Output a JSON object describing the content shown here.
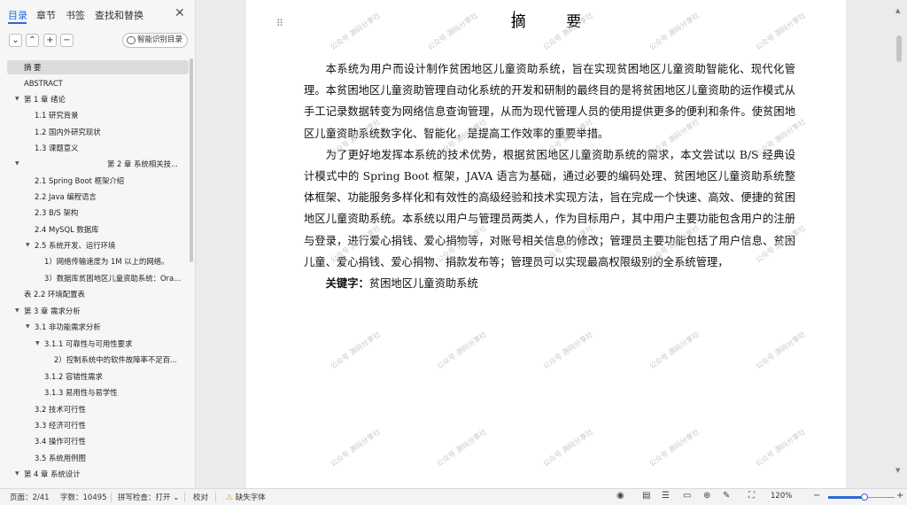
{
  "nav": {
    "tabs": [
      {
        "label": "目录",
        "active": true
      },
      {
        "label": "章节",
        "active": false
      },
      {
        "label": "书签",
        "active": false
      },
      {
        "label": "查找和替换",
        "active": false
      }
    ],
    "close_icon": "close-icon",
    "toolbar": {
      "collapse_icon": "chevron-down-icon",
      "expand_icon": "chevron-up-icon",
      "add_icon": "plus-icon",
      "remove_icon": "minus-icon",
      "smart_label": "智能识别目录"
    },
    "toc": [
      {
        "label": "摘    要",
        "selected": true
      },
      {
        "label": "ABSTRACT"
      },
      {
        "label": "第 1 章   绪论",
        "expanded": true
      },
      {
        "label": "1.1    研究背景"
      },
      {
        "label": "1.2    国内外研究现状"
      },
      {
        "label": "1.3    课题意义"
      },
      {
        "label": "第 2 章   系统相关技...",
        "expanded": true
      },
      {
        "label": "2.1 Spring Boot 框架介绍"
      },
      {
        "label": "2.2    Java 编程语言"
      },
      {
        "label": "2.3 B/S 架构"
      },
      {
        "label": "2.4 MySQL 数据库"
      },
      {
        "label": "2.5    系统开发、运行环境",
        "expanded": true
      },
      {
        "label": "1）网络传输速度为 1M 以上的网络。"
      },
      {
        "label": "3）数据库贫困地区儿童资助系统：Ora..."
      },
      {
        "label": "表 2.2    环境配置表"
      },
      {
        "label": "第 3 章   需求分析",
        "expanded": true
      },
      {
        "label": "3.1    非功能需求分析",
        "expanded": true
      },
      {
        "label": "3.1.1    可靠性与可用性要求",
        "expanded": true
      },
      {
        "label": "2）控制系统中的软件故障率不足百..."
      },
      {
        "label": "3.1.2    容错性需求"
      },
      {
        "label": "3.1.3    易用性与易学性"
      },
      {
        "label": "3.2    技术可行性"
      },
      {
        "label": "3.3    经济可行性"
      },
      {
        "label": "3.4    操作可行性"
      },
      {
        "label": "3.5 系统用例图"
      },
      {
        "label": "第 4 章   系统设计",
        "expanded": true
      }
    ]
  },
  "document": {
    "title": "摘    要",
    "paragraphs": [
      "本系统为用户而设计制作贫困地区儿童资助系统，旨在实现贫困地区儿童资助智能化、现代化管理。本贫困地区儿童资助管理自动化系统的开发和研制的最终目的是将贫困地区儿童资助的运作模式从手工记录数据转变为网络信息查询管理，从而为现代管理人员的使用提供更多的便利和条件。使贫困地区儿童资助系统数字化、智能化，是提高工作效率的重要举措。",
      "为了更好地发挥本系统的技术优势，根据贫困地区儿童资助系统的需求，本文尝试以 B/S 经典设计模式中的 Spring Boot 框架，JAVA 语言为基础，通过必要的编码处理、贫困地区儿童资助系统整体框架、功能服务多样化和有效性的高级经验和技术实现方法，旨在完成一个快速、高效、便捷的贫困地区儿童资助系统。本系统以用户与管理员两类人，作为目标用户，其中用户主要功能包含用户的注册与登录，进行爱心捐钱、爱心捐物等，对账号相关信息的修改；管理员主要功能包括了用户信息、贫困儿童、爱心捐钱、爱心捐物、捐款发布等；管理员可以实现最高权限级别的全系统管理，"
    ],
    "keywords_label": "关键字：",
    "keywords": "贫困地区儿童资助系统",
    "watermark": "公众号 源码分享社",
    "drag_icon": "drag-handle-icon"
  },
  "status": {
    "page": "页面：2/41",
    "words": "字数：10495",
    "spellcheck": "拼写检查：打开",
    "proofread": "校对",
    "missing_font": "缺失字体",
    "zoom": "120%",
    "zoom_level_fraction": 0.55,
    "icons": [
      "eye-icon",
      "page-view-icon",
      "outline-view-icon",
      "web-layout-icon",
      "read-mode-icon",
      "globe-icon",
      "pen-icon",
      "fit-page-icon",
      "zoom-out-icon",
      "zoom-in-icon"
    ]
  }
}
